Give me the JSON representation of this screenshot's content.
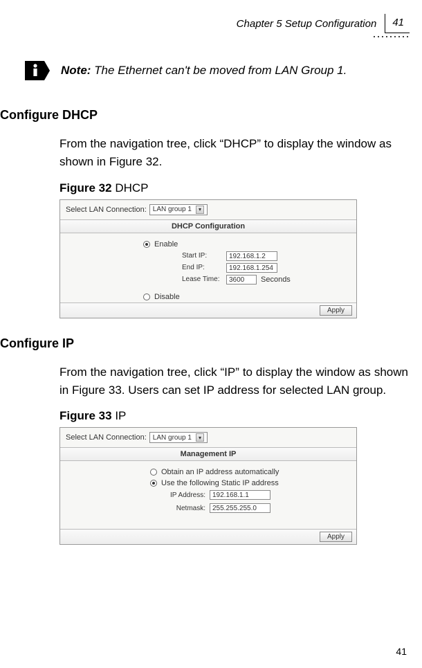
{
  "header": {
    "chapter": "Chapter 5 Setup Configuration",
    "page": "41"
  },
  "note": {
    "label": "Note:",
    "text": " The Ethernet can't be moved from LAN Group 1."
  },
  "dhcp": {
    "heading": "Configure DHCP",
    "intro": "From the navigation tree, click “DHCP” to display the window as shown in Figure 32.",
    "figure_bold": "Figure 32",
    "figure_rest": " DHCP",
    "ui": {
      "select_label": "Select LAN Connection:",
      "select_value": "LAN group 1",
      "panel_title": "DHCP Configuration",
      "enable": "Enable",
      "disable": "Disable",
      "start_ip_label": "Start IP:",
      "start_ip_value": "192.168.1.2",
      "end_ip_label": "End IP:",
      "end_ip_value": "192.168.1.254",
      "lease_label": "Lease Time:",
      "lease_value": "3600",
      "seconds": "Seconds",
      "apply": "Apply"
    }
  },
  "ip": {
    "heading": "Configure IP",
    "intro": "From the navigation tree, click “IP” to display the window as shown in Figure 33. Users can set IP address for selected LAN group.",
    "figure_bold": "Figure 33",
    "figure_rest": " IP",
    "ui": {
      "select_label": "Select LAN Connection:",
      "select_value": "LAN group 1",
      "panel_title": "Management IP",
      "obtain": "Obtain an IP address automatically",
      "use_static": "Use the following Static IP address",
      "ip_label": "IP Address:",
      "ip_value": "192.168.1.1",
      "netmask_label": "Netmask:",
      "netmask_value": "255.255.255.0",
      "apply": "Apply"
    }
  },
  "footer_page": "41"
}
